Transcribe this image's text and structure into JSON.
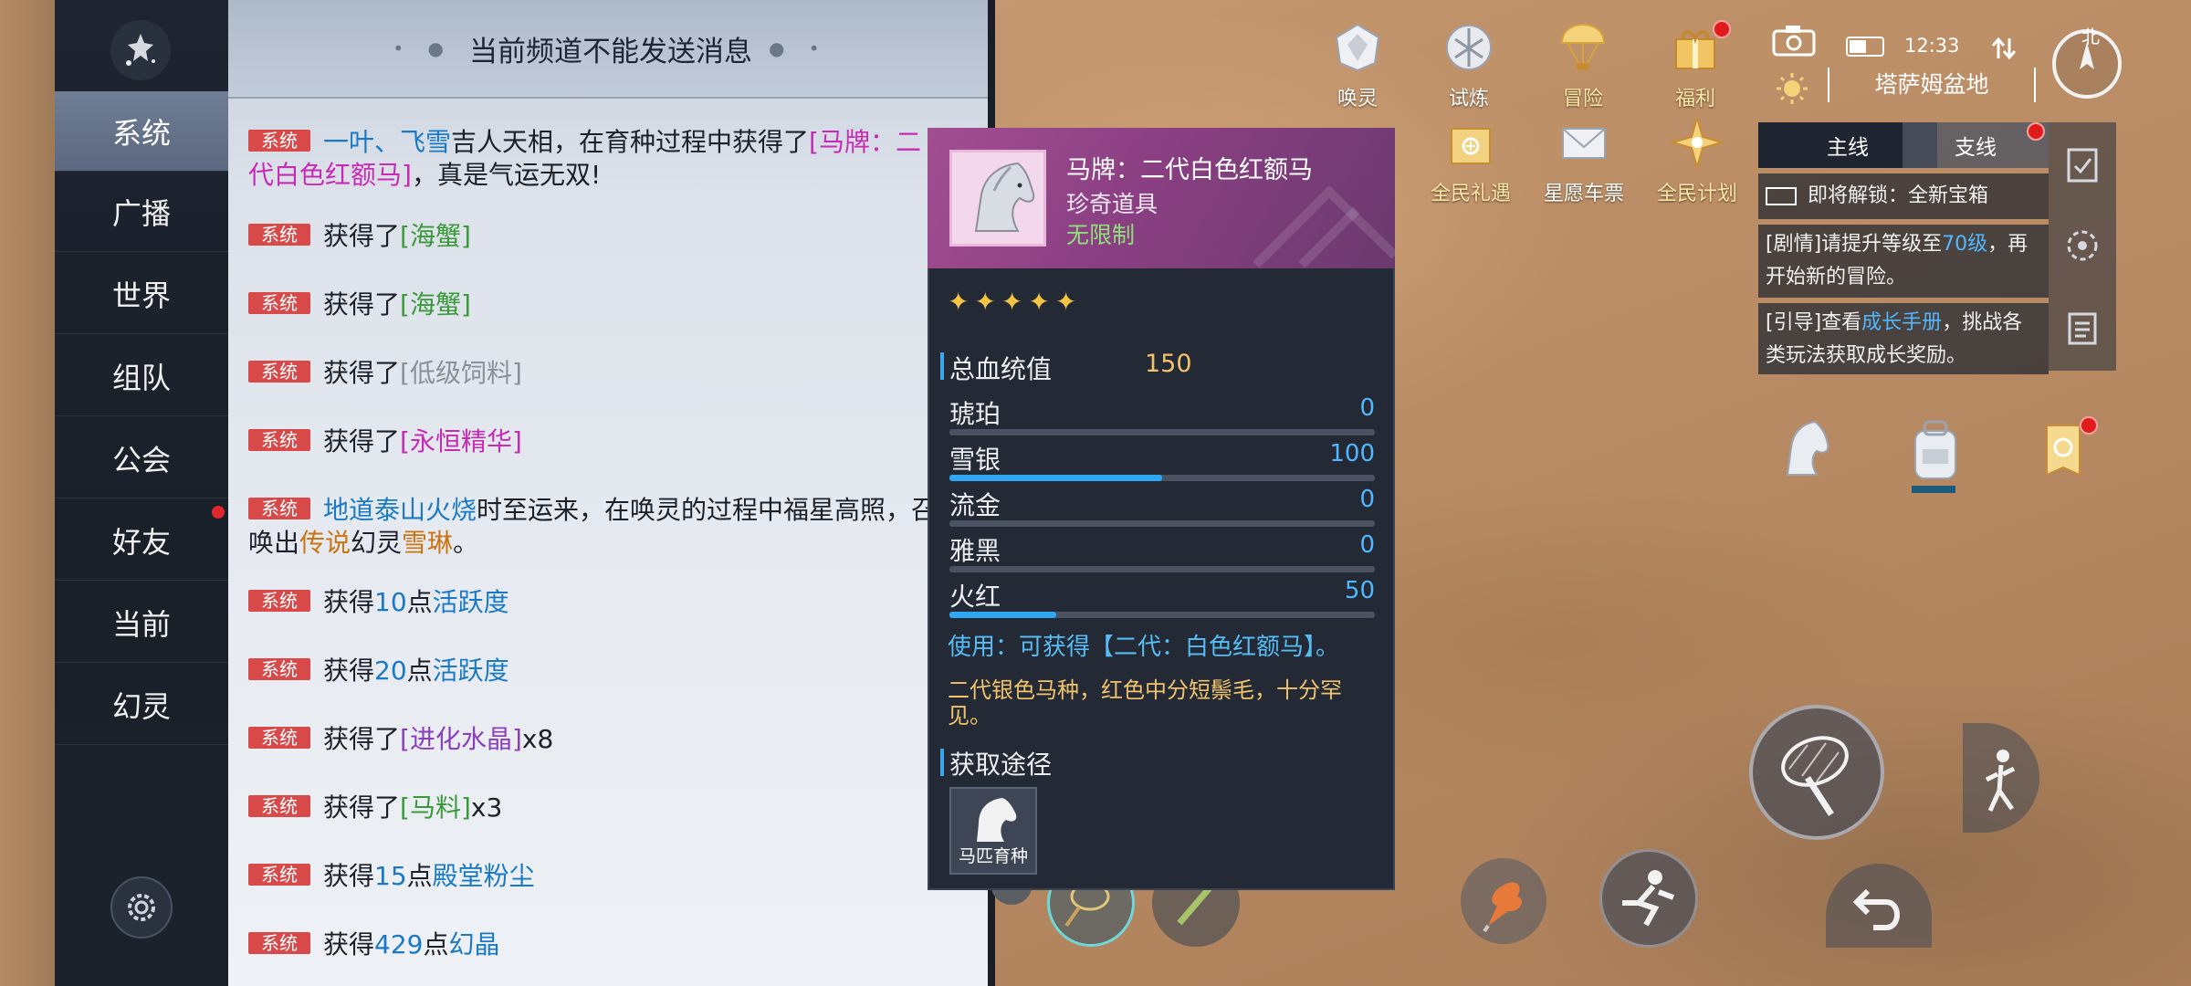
{
  "sidebar": {
    "tabs": [
      "系统",
      "广播",
      "世界",
      "组队",
      "公会",
      "好友",
      "当前",
      "幻灵"
    ],
    "active_tab": "系统"
  },
  "chat": {
    "header_title": "当前频道不能发送消息",
    "badge": "系统",
    "messages": [
      {
        "pre": "",
        "p1": "一叶、飞雪",
        "mid": "吉人天相，在育种过程中获得了",
        "p2": "[马牌：二代白色红额马]",
        "post": "，真是气运无双!"
      },
      {
        "pre": "获得了",
        "item": "[海蟹]"
      },
      {
        "pre": "获得了",
        "item": "[海蟹]"
      },
      {
        "pre": "获得了",
        "item": "[低级饲料]"
      },
      {
        "pre": "获得了",
        "item": "[永恒精华]"
      },
      {
        "p1": "地道泰山火烧",
        "mid": "时至运来，在唤灵的过程中福星高照，召",
        "line2a": "唤出",
        "p2": "传说",
        "line2b": "幻灵",
        "p3": "雪琳",
        "post": "。"
      },
      {
        "pre": "获得",
        "num": "10",
        "mid": "点",
        "item": "活跃度"
      },
      {
        "pre": "获得",
        "num": "20",
        "mid": "点",
        "item": "活跃度"
      },
      {
        "pre": "获得了",
        "item": "[进化水晶]",
        "post": "x8"
      },
      {
        "pre": "获得了",
        "item": "[马料]",
        "post": "x3"
      },
      {
        "pre": "获得",
        "num": "15",
        "mid": "点",
        "item": "殿堂粉尘"
      },
      {
        "pre": "获得",
        "num": "429",
        "mid": "点",
        "item": "幻晶"
      }
    ]
  },
  "tooltip": {
    "name": "马牌：二代白色红额马",
    "category": "珍奇道具",
    "limit": "无限制",
    "stars": "✦✦✦✦✦",
    "total_label": "总血统值",
    "total_value": "150",
    "stats": [
      {
        "name": "琥珀",
        "value": 0,
        "max": 200
      },
      {
        "name": "雪银",
        "value": 100,
        "max": 200
      },
      {
        "name": "流金",
        "value": 0,
        "max": 200
      },
      {
        "name": "雅黑",
        "value": 0,
        "max": 200
      },
      {
        "name": "火红",
        "value": 50,
        "max": 200
      }
    ],
    "use_text": "使用：可获得【二代：白色红额马】。",
    "desc": "二代银色马种，红色中分短鬃毛，十分罕见。",
    "source_label": "获取途径",
    "source_item": "马匹育种"
  },
  "hud": {
    "icons_row1": [
      "唤灵",
      "试炼",
      "冒险",
      "福利"
    ],
    "icons_row2": [
      "全民礼遇",
      "星愿车票",
      "全民计划"
    ],
    "time": "12:33",
    "location": "塔萨姆盆地",
    "compass": "北",
    "quest_tabs": [
      "主线",
      "支线"
    ],
    "quest_unlock": "即将解锁：全新宝箱",
    "quest1_pre": "[剧情]请提升等级至",
    "quest1_hl": "70级",
    "quest1_post": "，再开始新的冒险。",
    "quest2_pre": "[引导]查看",
    "quest2_hl": "成长手册",
    "quest2_post": "，挑战各类玩法获取成长奖励。"
  }
}
